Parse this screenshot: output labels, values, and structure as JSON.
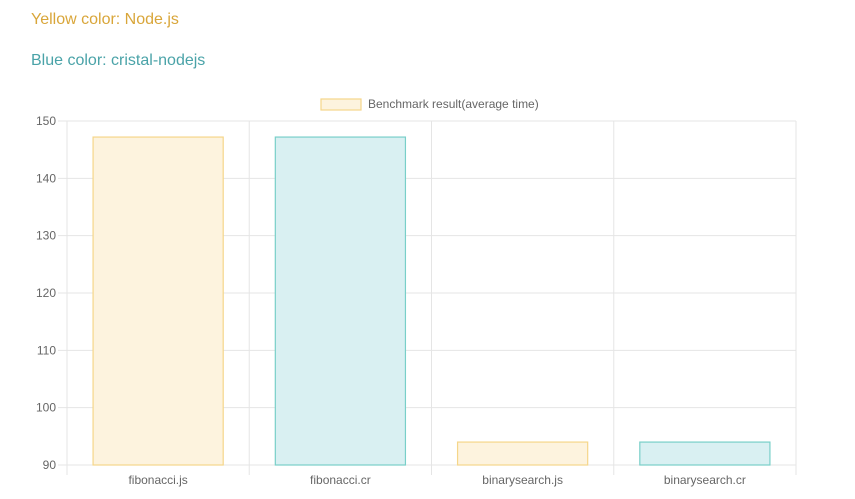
{
  "captions": {
    "yellow": "Yellow color: Node.js",
    "blue": "Blue color: cristal-nodejs"
  },
  "colors": {
    "yellow_text": "#d9a63a",
    "blue_text": "#4aa3a8",
    "yellow_fill": "#fdf3de",
    "yellow_border": "#f5d68a",
    "blue_fill": "#d9f0f2",
    "blue_border": "#79cfc9",
    "grid": "#e5e5e5",
    "tick_text": "#666666"
  },
  "chart_data": {
    "type": "bar",
    "legend": {
      "label": "Benchmark result(average time)",
      "position": "top"
    },
    "categories": [
      "fibonacci.js",
      "fibonacci.cr",
      "binarysearch.js",
      "binarysearch.cr"
    ],
    "series": [
      {
        "name": "Benchmark result(average time)",
        "values": [
          147.2,
          147.2,
          94.0,
          94.0
        ],
        "bar_colors": [
          "yellow",
          "blue",
          "yellow",
          "blue"
        ]
      }
    ],
    "ylim": [
      90,
      150
    ],
    "yticks": [
      90,
      100,
      110,
      120,
      130,
      140,
      150
    ],
    "grid": true
  }
}
